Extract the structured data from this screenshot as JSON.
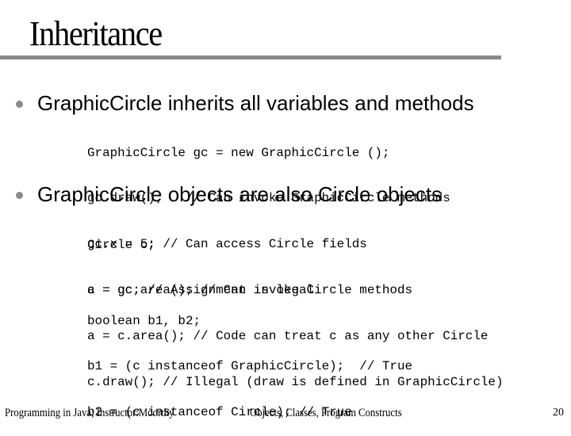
{
  "slide": {
    "title": "Inheritance",
    "bullets": [
      {
        "text": "GraphicCircle inherits all variables and methods",
        "code_lines": [
          "GraphicCircle gc = new GraphicCircle ();",
          "gc.draw();   // Can invoke GraphicCircle methods",
          "gc.x = 5; // Can access Circle fields",
          "a = gc.area(); // Can invoke Circle methods"
        ]
      },
      {
        "text": "GraphicCircle objects are also Circle objects",
        "code_lines": [
          "Circle c;",
          "c = gc; // Assignment is legal",
          "a = c.area(); // Code can treat c as any other Circle",
          "c.draw(); // Illegal (draw is defined in GraphicCircle)"
        ],
        "code_lines_2": [
          "boolean b1, b2;",
          "b1 = (c instanceof GraphicCircle);  // True",
          "b2 = (c instanceof Circle); // True"
        ]
      }
    ],
    "bullet_icon": "filled-circle-bullet",
    "colors": {
      "rule": "#888888",
      "bullet": "#8a8a8a",
      "text": "#000000",
      "background": "#ffffff"
    }
  },
  "footer": {
    "course": "Programming in Java; Instructor:Moorthy",
    "topic": "Objects, Classes, Program Constructs",
    "page_number": "20"
  }
}
